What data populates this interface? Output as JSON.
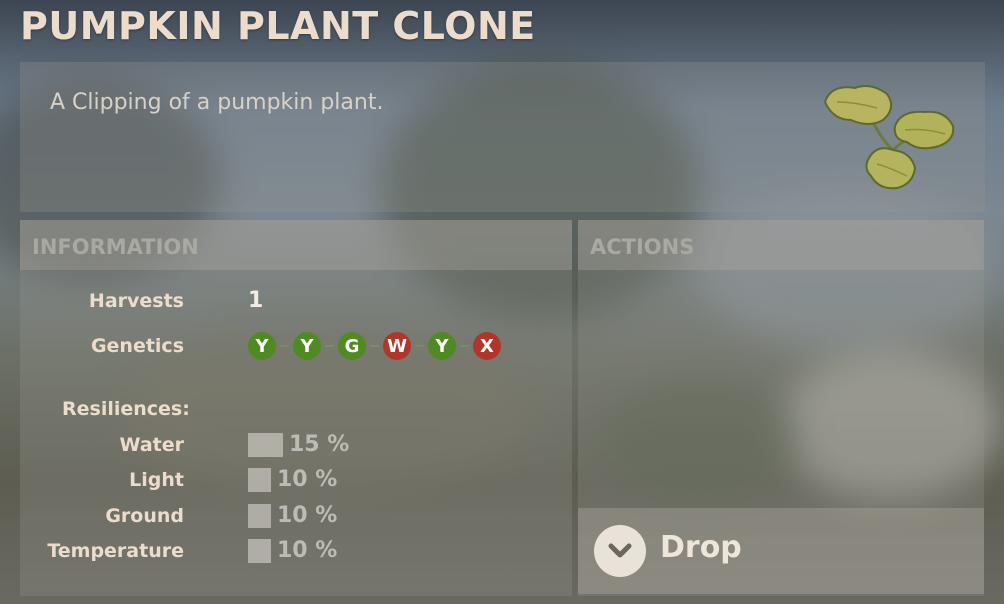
{
  "item": {
    "title": "PUMPKIN PLANT CLONE",
    "description": "A Clipping of a pumpkin plant.",
    "icon": "pumpkin-clone-leaves-icon"
  },
  "information": {
    "header": "INFORMATION",
    "harvests_label": "Harvests",
    "harvests_value": "1",
    "genetics_label": "Genetics",
    "genes": [
      {
        "letter": "Y",
        "color": "#4f8a22"
      },
      {
        "letter": "Y",
        "color": "#4f8a22"
      },
      {
        "letter": "G",
        "color": "#4f8a22"
      },
      {
        "letter": "W",
        "color": "#b0352b"
      },
      {
        "letter": "Y",
        "color": "#4f8a22"
      },
      {
        "letter": "X",
        "color": "#b0352b"
      }
    ],
    "resiliences_label": "Resiliences:",
    "resiliences": [
      {
        "label": "Water",
        "value": "15 %",
        "level": 15
      },
      {
        "label": "Light",
        "value": "10 %",
        "level": 10
      },
      {
        "label": "Ground",
        "value": "10 %",
        "level": 10
      },
      {
        "label": "Temperature",
        "value": "10 %",
        "level": 10
      }
    ]
  },
  "actions": {
    "header": "ACTIONS",
    "drop_label": "Drop",
    "drop_icon": "chevron-down-icon"
  }
}
